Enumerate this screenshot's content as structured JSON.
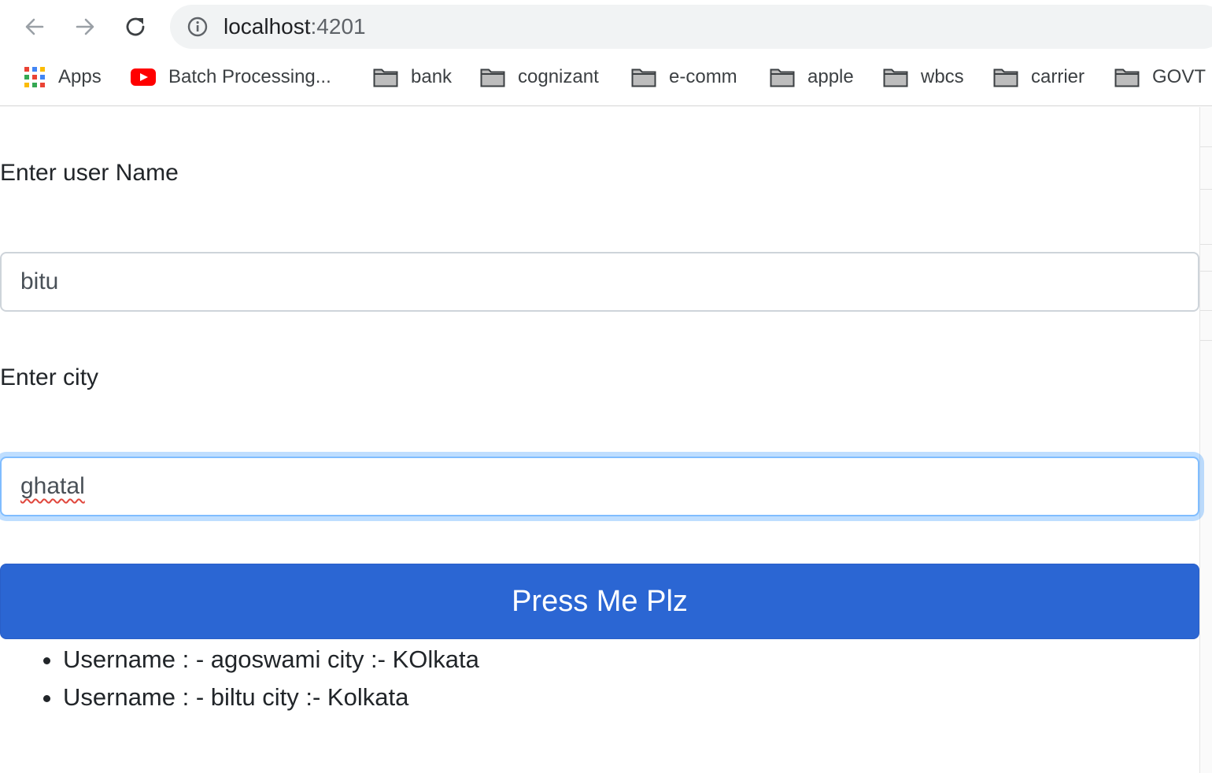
{
  "browser": {
    "url_host": "localhost",
    "url_port": ":4201",
    "bookmarks": [
      {
        "label": "Apps",
        "icon": "apps-grid-icon"
      },
      {
        "label": "Batch Processing...",
        "icon": "youtube-icon"
      },
      {
        "label": "bank",
        "icon": "folder-icon"
      },
      {
        "label": "cognizant",
        "icon": "folder-icon"
      },
      {
        "label": "e-comm",
        "icon": "folder-icon"
      },
      {
        "label": "apple",
        "icon": "folder-icon"
      },
      {
        "label": "wbcs",
        "icon": "folder-icon"
      },
      {
        "label": "carrier",
        "icon": "folder-icon"
      },
      {
        "label": "GOVT",
        "icon": "folder-icon"
      }
    ]
  },
  "form": {
    "username_label": "Enter user Name",
    "username_value": "bitu",
    "city_label": "Enter city",
    "city_value": "ghatal",
    "submit_label": "Press Me Plz"
  },
  "results": [
    "Username : - agoswami city :- KOlkata",
    "Username : - biltu city :- Kolkata"
  ],
  "colors": {
    "button_bg": "#2b66d3",
    "focus_border": "#80bdff",
    "text": "#212529"
  }
}
